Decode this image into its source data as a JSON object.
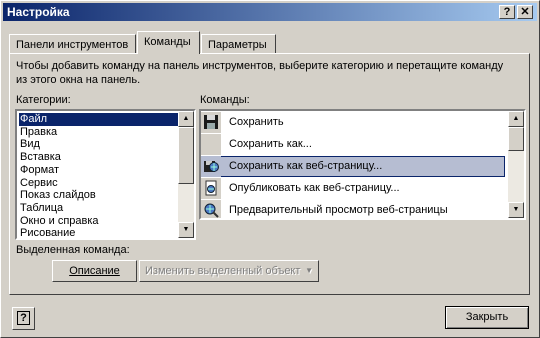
{
  "window": {
    "title": "Настройка",
    "help_glyph": "?",
    "close_glyph": "✕"
  },
  "tabs": [
    {
      "label": "Панели инструментов",
      "active": false
    },
    {
      "label": "Команды",
      "active": true
    },
    {
      "label": "Параметры",
      "active": false
    }
  ],
  "intro_text": "Чтобы добавить команду на панель инструментов, выберите категорию и перетащите команду из этого окна на панель.",
  "categories": {
    "label": "Категории:",
    "items": [
      "Файл",
      "Правка",
      "Вид",
      "Вставка",
      "Формат",
      "Сервис",
      "Показ слайдов",
      "Таблица",
      "Окно и справка",
      "Рисование"
    ],
    "selected_index": 0
  },
  "commands": {
    "label": "Команды:",
    "items": [
      {
        "label": "Сохранить",
        "icon": "save-icon"
      },
      {
        "label": "Сохранить как...",
        "icon": ""
      },
      {
        "label": "Сохранить как веб-страницу...",
        "icon": "save-web-icon"
      },
      {
        "label": "Опубликовать как веб-страницу...",
        "icon": "publish-web-icon"
      },
      {
        "label": "Предварительный просмотр веб-страницы",
        "icon": "web-preview-icon"
      }
    ],
    "selected_index": 2
  },
  "selected_command": {
    "label": "Выделенная команда:",
    "description_button": "Описание",
    "modify_button": "Изменить выделенный объект"
  },
  "footer": {
    "help_button_glyph": "?",
    "close_button": "Закрыть"
  },
  "colors": {
    "titlebar_start": "#0a246a",
    "titlebar_end": "#a6caf0",
    "selection": "#0a246a",
    "face": "#d4d0c8"
  }
}
